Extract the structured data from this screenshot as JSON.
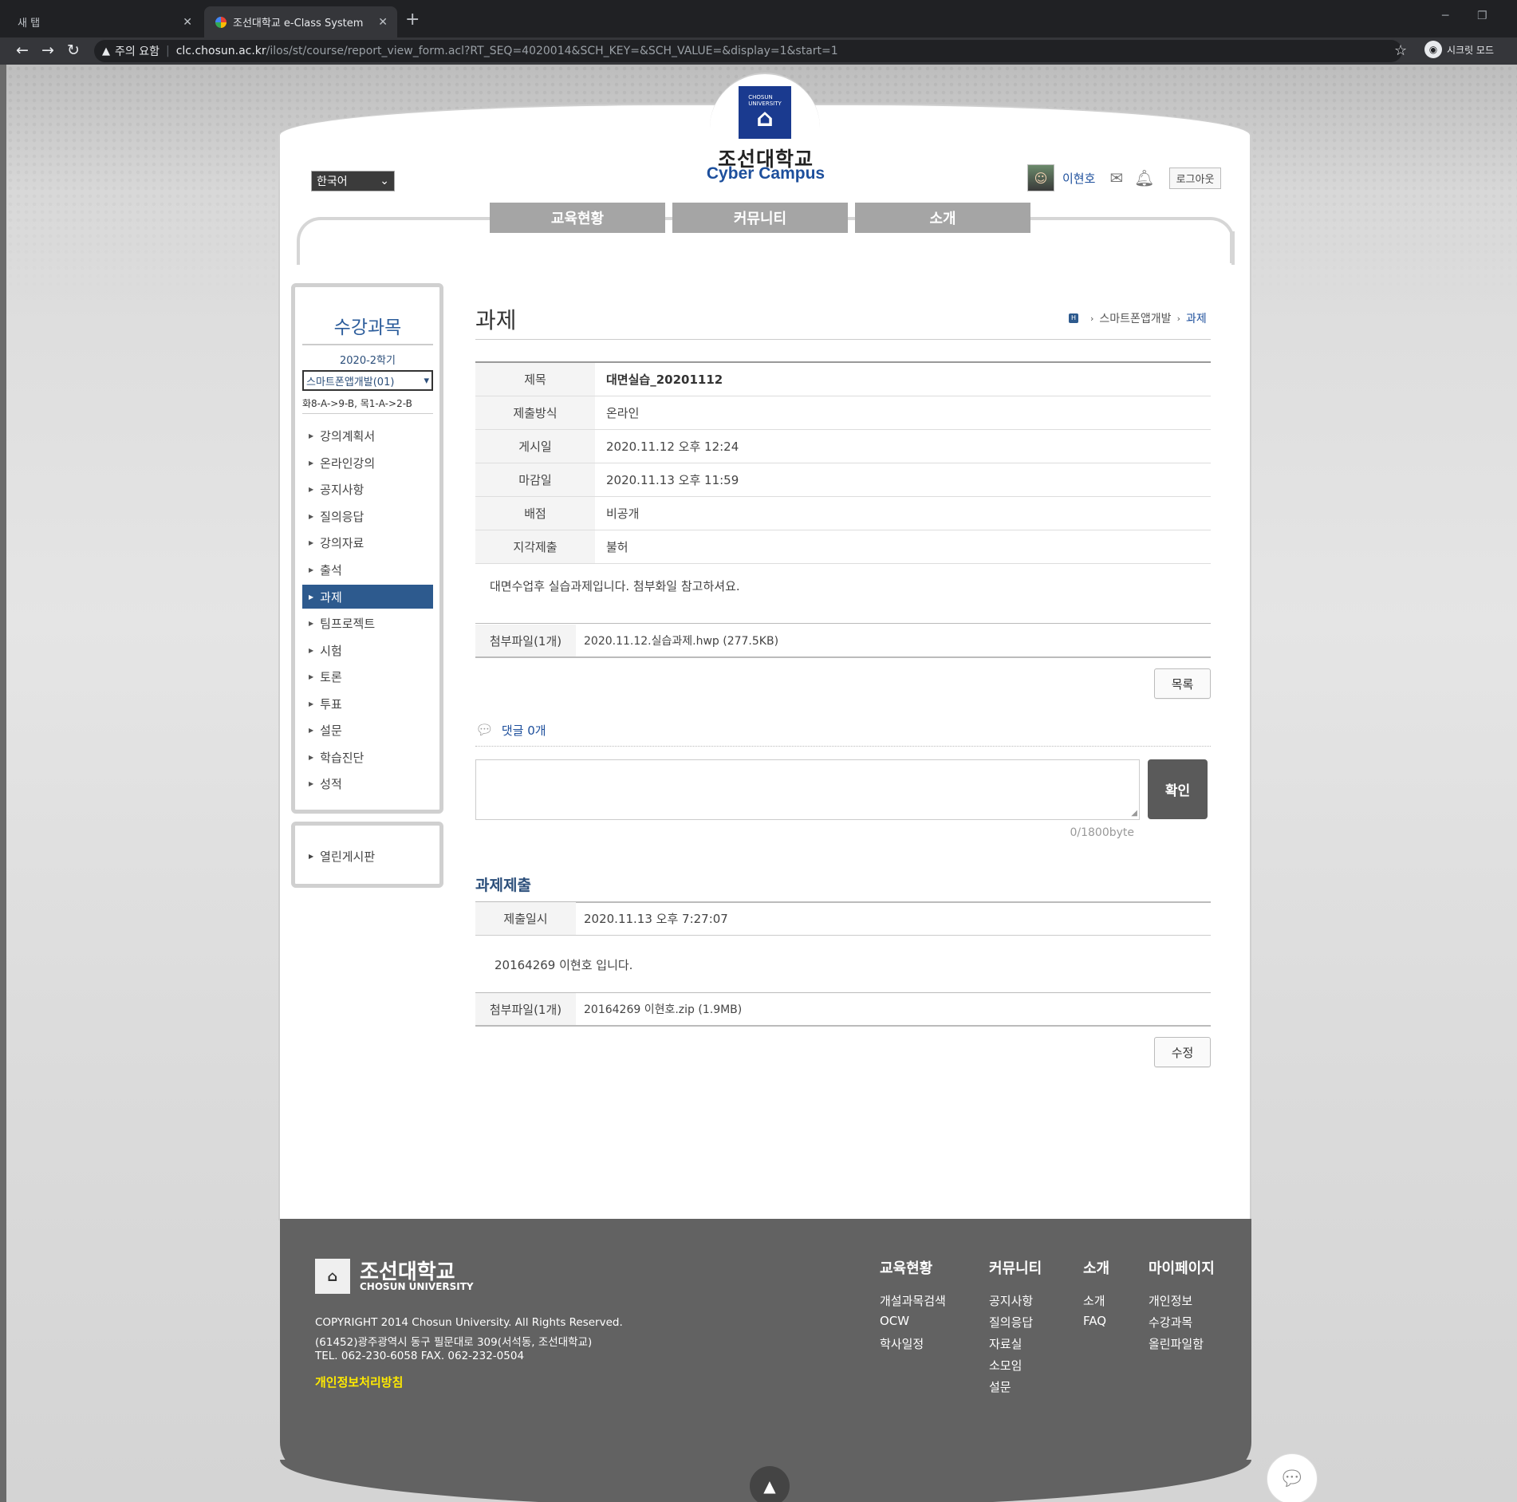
{
  "browser": {
    "tabs": [
      {
        "label": "새 탭"
      },
      {
        "label": "조선대학교 e-Class System"
      }
    ],
    "security_label": "주의 요함",
    "url_host": "clc.chosun.ac.kr",
    "url_path": "/ilos/st/course/report_view_form.acl?RT_SEQ=4020014&SCH_KEY=&SCH_VALUE=&display=1&start=1",
    "incognito_label": "시크릿 모드"
  },
  "header": {
    "brand_kr": "조선대학교",
    "brand_en": "Cyber Campus",
    "language": "한국어",
    "user_name": "이현호",
    "logout_label": "로그아웃",
    "nav": [
      "교육현황",
      "커뮤니티",
      "소개"
    ]
  },
  "sidebar": {
    "title": "수강과목",
    "term": "2020-2학기",
    "course": "스마트폰앱개발(01)",
    "schedule": "화8-A->9-B, 목1-A->2-B",
    "menu": [
      "강의계획서",
      "온라인강의",
      "공지사항",
      "질의응답",
      "강의자료",
      "출석",
      "과제",
      "팀프로젝트",
      "시험",
      "토론",
      "투표",
      "설문",
      "학습진단",
      "성적"
    ],
    "active": "과제",
    "board": "열린게시판"
  },
  "content": {
    "title": "과제",
    "breadcrumb": [
      "스마트폰앱개발",
      "과제"
    ],
    "info": [
      {
        "label": "제목",
        "value": "대면실습_20201112"
      },
      {
        "label": "제출방식",
        "value": "온라인"
      },
      {
        "label": "게시일",
        "value": "2020.11.12 오후 12:24"
      },
      {
        "label": "마감일",
        "value": "2020.11.13 오후 11:59"
      },
      {
        "label": "배점",
        "value": "비공개"
      },
      {
        "label": "지각제출",
        "value": "불허"
      }
    ],
    "body": "대면수업후 실습과제입니다. 첨부화일 참고하셔요.",
    "attach_label": "첨부파일(1개)",
    "attach_file": "2020.11.12.실습과제.hwp (277.5KB)",
    "list_button": "목록",
    "comments_label": "댓글 0개",
    "confirm_button": "확인",
    "byte_counter": "0/1800byte",
    "submission": {
      "title": "과제제출",
      "date_label": "제출일시",
      "date_value": "2020.11.13 오후 7:27:07",
      "body": "20164269 이현호 입니다.",
      "attach_label": "첨부파일(1개)",
      "attach_file": "20164269 이현호.zip (1.9MB)",
      "edit_button": "수정"
    }
  },
  "footer": {
    "logo_kr": "조선대학교",
    "logo_en": "CHOSUN UNIVERSITY",
    "copyright": "COPYRIGHT 2014 Chosun University. All Rights Reserved.",
    "address": "(61452)광주광역시 동구 필문대로 309(서석동, 조선대학교)",
    "contact": "TEL. 062-230-6058 FAX. 062-232-0504",
    "privacy": "개인정보처리방침",
    "columns": [
      {
        "title": "교육현황",
        "links": [
          "개설과목검색",
          "OCW",
          "학사일정"
        ]
      },
      {
        "title": "커뮤니티",
        "links": [
          "공지사항",
          "질의응답",
          "자료실",
          "소모임",
          "설문"
        ]
      },
      {
        "title": "소개",
        "links": [
          "소개",
          "FAQ"
        ]
      },
      {
        "title": "마이페이지",
        "links": [
          "개인정보",
          "수강과목",
          "올린파일함"
        ]
      }
    ]
  },
  "icons": {
    "accent": "#2d5a8e",
    "nav_bg": "#a5a5a5",
    "footer_bg": "#626262",
    "privacy_color": "#ffea00"
  }
}
